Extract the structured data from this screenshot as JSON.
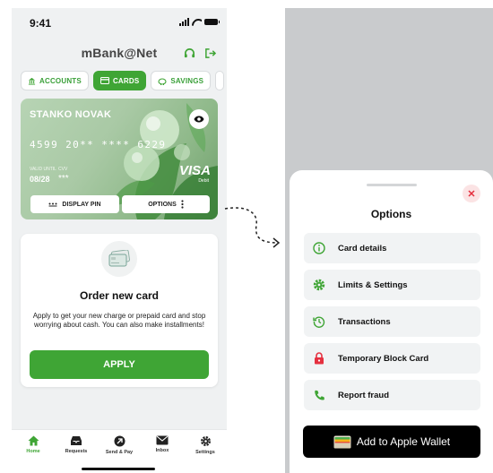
{
  "status_bar": {
    "time": "9:41"
  },
  "app": {
    "title": "mBank@Net"
  },
  "tabs": [
    {
      "label": "ACCOUNTS",
      "icon": "bank-icon",
      "active": false
    },
    {
      "label": "CARDS",
      "icon": "card-icon",
      "active": true
    },
    {
      "label": "SAVINGS",
      "icon": "piggy-icon",
      "active": false
    }
  ],
  "card": {
    "holder": "STANKO NOVAK",
    "number": "4599 20** **** 6229",
    "valid_label": "VALID UNTIL",
    "cvv_label": "CVV",
    "expiry": "08/28",
    "cvv": "***",
    "brand": "VISA",
    "brand_sub": "Debit",
    "display_pin_label": "DISPLAY PIN",
    "options_label": "OPTIONS"
  },
  "order_card": {
    "title": "Order new card",
    "description": "Apply to get your new charge or prepaid card and stop worrying about cash. You can also make installments!",
    "button": "APPLY"
  },
  "bottom_nav": [
    {
      "label": "Home",
      "icon": "home-icon",
      "active": true
    },
    {
      "label": "Requests",
      "icon": "inbox-tray-icon",
      "active": false
    },
    {
      "label": "Send & Pay",
      "icon": "send-icon",
      "active": false
    },
    {
      "label": "Inbox",
      "icon": "mail-icon",
      "active": false
    },
    {
      "label": "Settings",
      "icon": "gear-icon",
      "active": false
    }
  ],
  "options_sheet": {
    "title": "Options",
    "items": [
      {
        "label": "Card details",
        "icon": "info-icon",
        "color": "#3fa535"
      },
      {
        "label": "Limits & Settings",
        "icon": "gear-icon",
        "color": "#3fa535"
      },
      {
        "label": "Transactions",
        "icon": "history-icon",
        "color": "#3fa535"
      },
      {
        "label": "Temporary Block Card",
        "icon": "lock-icon",
        "color": "#e5303f"
      },
      {
        "label": "Report fraud",
        "icon": "phone-icon",
        "color": "#3fa535"
      }
    ],
    "wallet_button": "Add to Apple Wallet"
  },
  "colors": {
    "accent": "#3fa535",
    "danger": "#e5303f"
  }
}
